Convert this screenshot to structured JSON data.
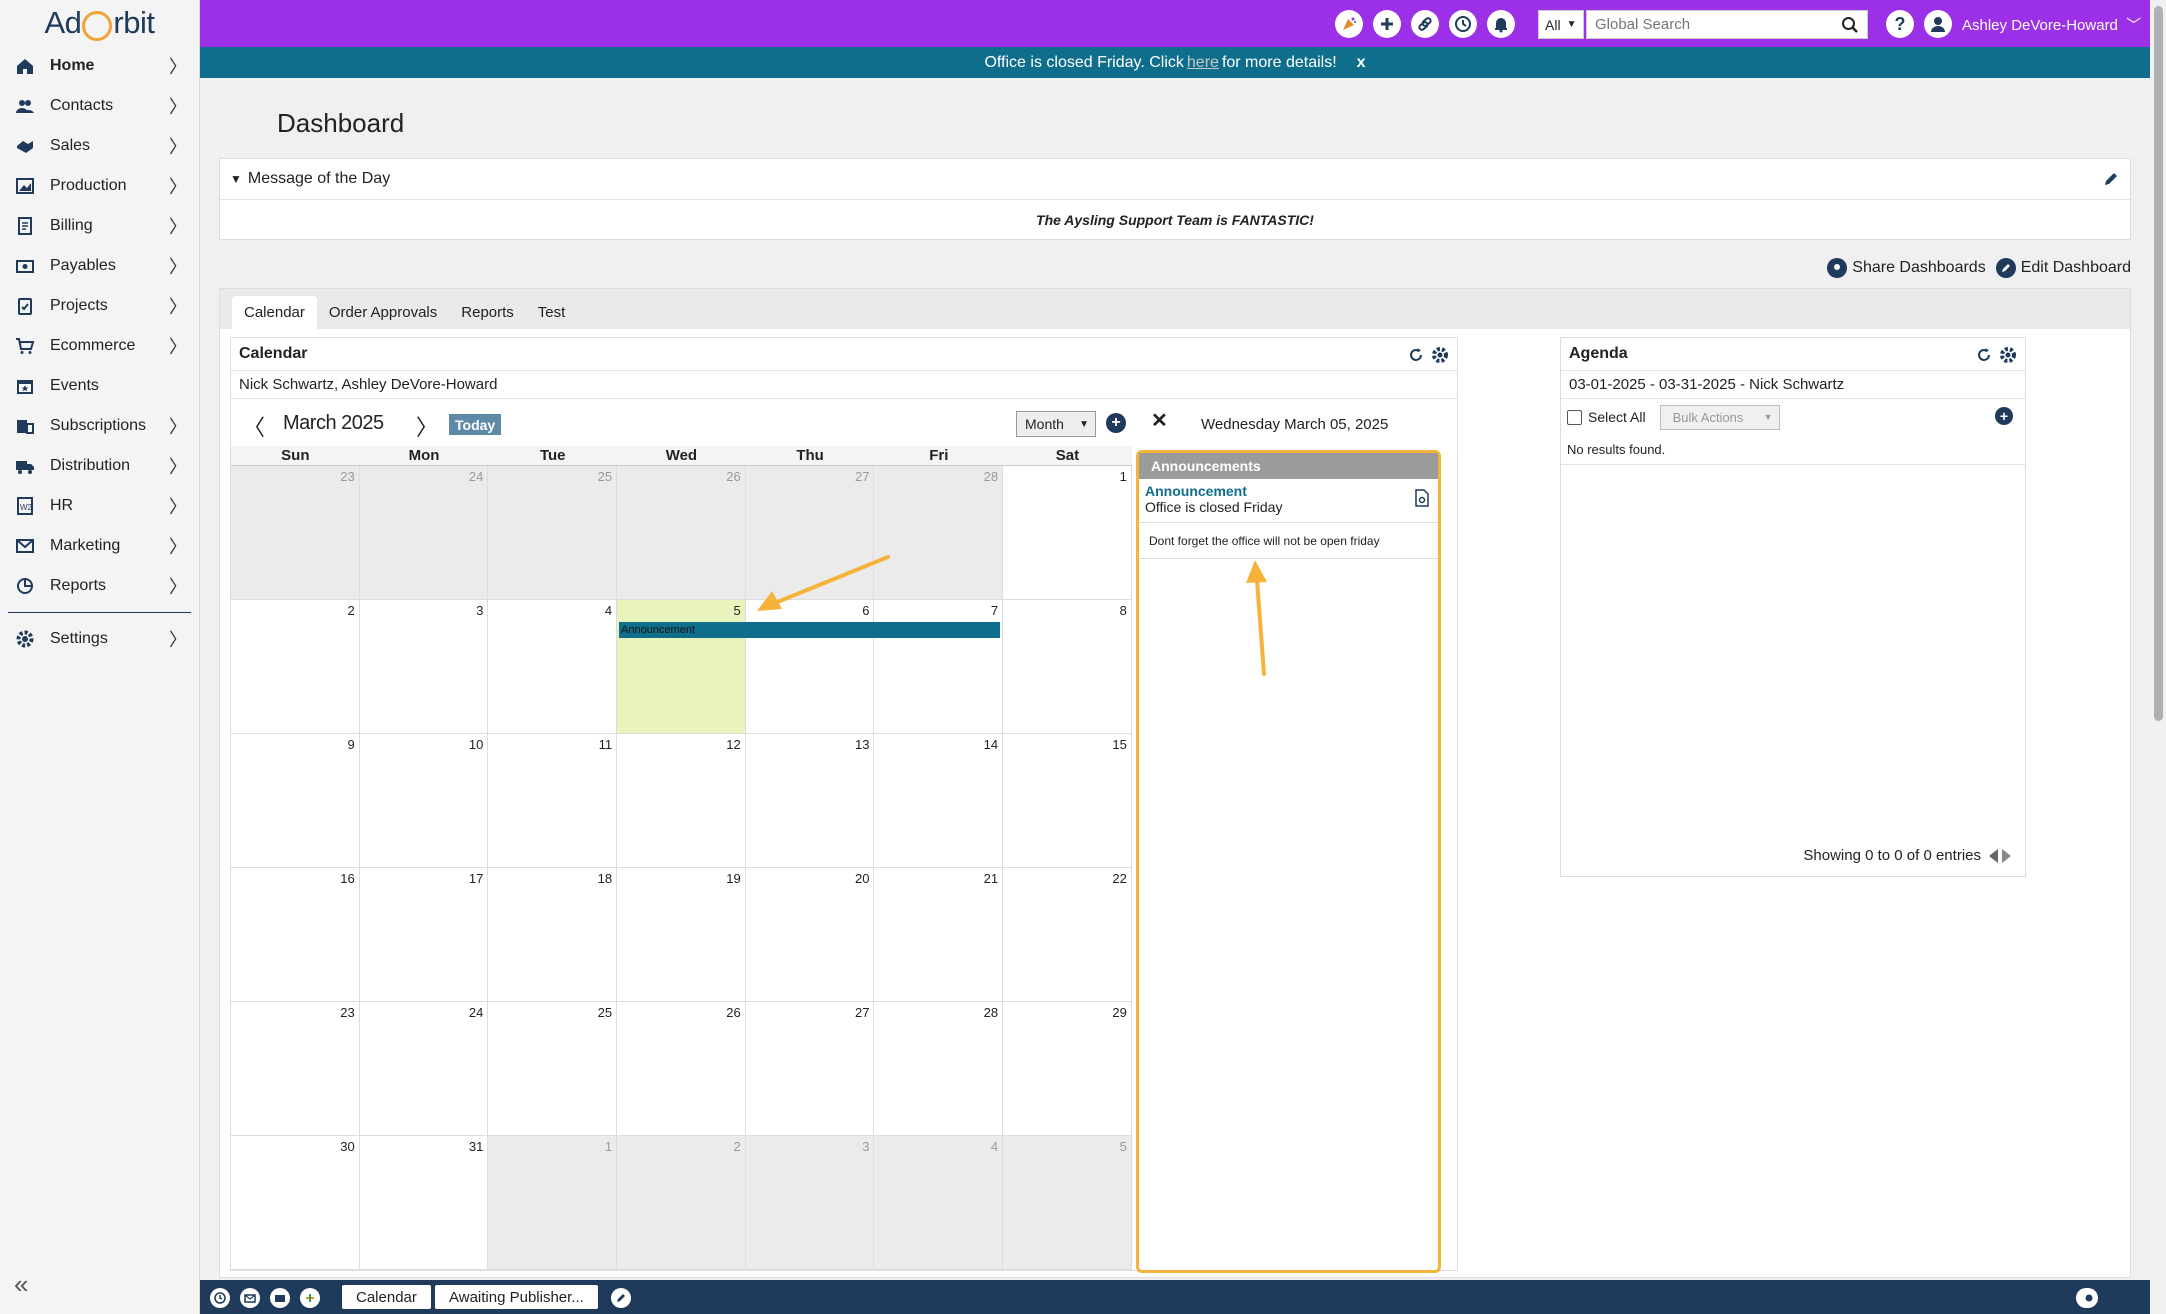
{
  "app": {
    "logo_text_left": "Ad",
    "logo_text_right": "rbit",
    "brand_color": "#9b30e8",
    "accent_color": "#0f6e8c"
  },
  "sidebar": {
    "items": [
      {
        "label": "Home",
        "icon": "home-icon"
      },
      {
        "label": "Contacts",
        "icon": "contacts-icon"
      },
      {
        "label": "Sales",
        "icon": "sales-icon"
      },
      {
        "label": "Production",
        "icon": "production-icon"
      },
      {
        "label": "Billing",
        "icon": "billing-icon"
      },
      {
        "label": "Payables",
        "icon": "payables-icon"
      },
      {
        "label": "Projects",
        "icon": "projects-icon"
      },
      {
        "label": "Ecommerce",
        "icon": "cart-icon"
      },
      {
        "label": "Events",
        "icon": "events-icon"
      },
      {
        "label": "Subscriptions",
        "icon": "subscriptions-icon"
      },
      {
        "label": "Distribution",
        "icon": "truck-icon"
      },
      {
        "label": "HR",
        "icon": "hr-icon"
      },
      {
        "label": "Marketing",
        "icon": "mail-icon"
      },
      {
        "label": "Reports",
        "icon": "reports-icon"
      }
    ],
    "settings_label": "Settings"
  },
  "topbar": {
    "search_scope": "All",
    "search_placeholder": "Global Search",
    "user_name": "Ashley DeVore-Howard"
  },
  "banner": {
    "text_before": "Office is closed Friday. Click",
    "link_text": "here",
    "text_after": "for more details!",
    "close": "x"
  },
  "page": {
    "title": "Dashboard"
  },
  "motd": {
    "title": "Message of the Day",
    "body": "The Aysling Support Team is FANTASTIC!"
  },
  "dashboard_actions": {
    "share": "Share Dashboards",
    "edit": "Edit Dashboard"
  },
  "tabs": [
    {
      "label": "Calendar",
      "active": true
    },
    {
      "label": "Order Approvals",
      "active": false
    },
    {
      "label": "Reports",
      "active": false
    },
    {
      "label": "Test",
      "active": false
    }
  ],
  "calendar": {
    "title": "Calendar",
    "users": "Nick Schwartz, Ashley DeVore-Howard",
    "month_label": "March 2025",
    "today_label": "Today",
    "view": "Month",
    "dow": [
      "Sun",
      "Mon",
      "Tue",
      "Wed",
      "Thu",
      "Fri",
      "Sat"
    ],
    "weeks": [
      [
        [
          "23",
          true
        ],
        [
          "24",
          true
        ],
        [
          "25",
          true
        ],
        [
          "26",
          true
        ],
        [
          "27",
          true
        ],
        [
          "28",
          true
        ],
        [
          "1",
          false
        ]
      ],
      [
        [
          "2",
          false
        ],
        [
          "3",
          false
        ],
        [
          "4",
          false
        ],
        [
          "5",
          false
        ],
        [
          "6",
          false
        ],
        [
          "7",
          false
        ],
        [
          "8",
          false
        ]
      ],
      [
        [
          "9",
          false
        ],
        [
          "10",
          false
        ],
        [
          "11",
          false
        ],
        [
          "12",
          false
        ],
        [
          "13",
          false
        ],
        [
          "14",
          false
        ],
        [
          "15",
          false
        ]
      ],
      [
        [
          "16",
          false
        ],
        [
          "17",
          false
        ],
        [
          "18",
          false
        ],
        [
          "19",
          false
        ],
        [
          "20",
          false
        ],
        [
          "21",
          false
        ],
        [
          "22",
          false
        ]
      ],
      [
        [
          "23",
          false
        ],
        [
          "24",
          false
        ],
        [
          "25",
          false
        ],
        [
          "26",
          false
        ],
        [
          "27",
          false
        ],
        [
          "28",
          false
        ],
        [
          "29",
          false
        ]
      ],
      [
        [
          "30",
          false
        ],
        [
          "31",
          false
        ],
        [
          "1",
          true
        ],
        [
          "2",
          true
        ],
        [
          "3",
          true
        ],
        [
          "4",
          true
        ],
        [
          "5",
          true
        ]
      ]
    ],
    "event_label": "Announcement"
  },
  "day_detail": {
    "close": "✕",
    "date": "Wednesday March 05, 2025",
    "section": "Announcements",
    "item_title": "Announcement",
    "item_subtitle": "Office is closed Friday",
    "description": "Dont forget the office will not be open friday"
  },
  "agenda": {
    "title": "Agenda",
    "range": "03-01-2025 - 03-31-2025 - Nick Schwartz",
    "select_all": "Select All",
    "bulk_actions": "Bulk Actions",
    "empty": "No results found.",
    "footer": "Showing 0 to 0 of 0 entries"
  },
  "bottombar": {
    "btn_calendar": "Calendar",
    "btn_awaiting": "Awaiting Publisher..."
  },
  "annotation_color": "#f6b33c"
}
